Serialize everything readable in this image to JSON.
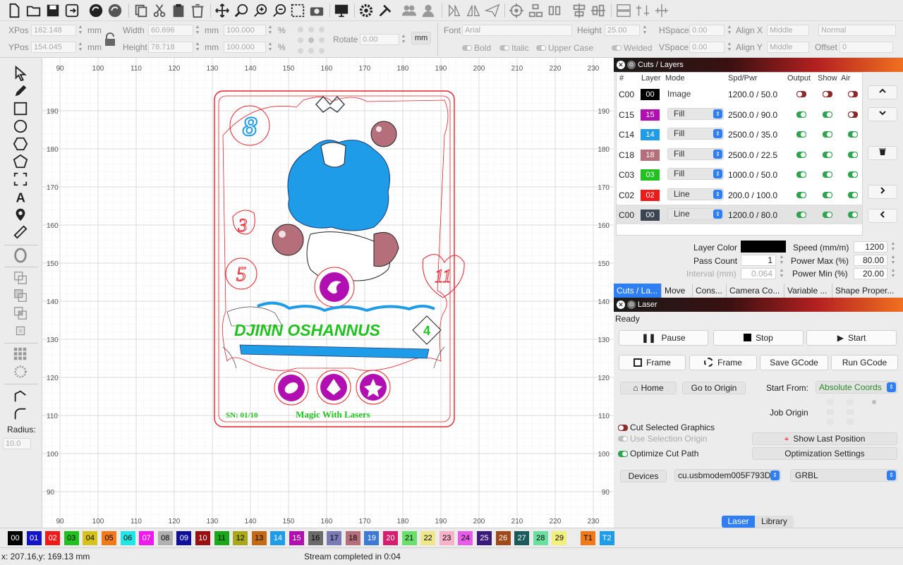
{
  "toolbar": {
    "icons": [
      "new-file-icon",
      "open-folder-icon",
      "save-icon",
      "export-icon",
      "circle-arrow-icon",
      "rotate-icon",
      "copy-icon",
      "cut-icon",
      "paste-icon",
      "trash-icon",
      "move-icon",
      "zoom-pan-icon",
      "zoom-in-icon",
      "zoom-out-icon",
      "select-area-icon",
      "camera-icon",
      "monitor-icon",
      "settings-icon",
      "tools-icon",
      "users-icon",
      "user-icon",
      "mirror-h-icon",
      "mirror-v-icon",
      "send-icon",
      "target-icon",
      "align-icon",
      "distribute-icon",
      "align-center-icon",
      "align-middle-icon",
      "group-icon",
      "ungroup-icon",
      "grid-icon"
    ]
  },
  "props": {
    "xpos_label": "XPos",
    "xpos_value": "162.148",
    "ypos_label": "YPos",
    "ypos_value": "154.045",
    "unit_mm": "mm",
    "width_label": "Width",
    "width_value": "60.696",
    "height_label": "Height",
    "height_value": "78.718",
    "scale_w": "100.000",
    "scale_h": "100.000",
    "pct": "%",
    "rotate_label": "Rotate",
    "rotate_value": "0.00",
    "mm_btn": "mm",
    "font_label": "Font",
    "font_value": "Arial",
    "fheight_label": "Height",
    "fheight_value": "25.00",
    "hspace_label": "HSpace",
    "hspace_value": "0.00",
    "vspace_label": "VSpace",
    "vspace_value": "0.00",
    "alignx_label": "Align X",
    "alignx_value": "Middle",
    "aligny_label": "Align Y",
    "aligny_value": "Middle",
    "normal_value": "Normal",
    "offset_label": "Offset",
    "offset_value": "0",
    "bold": "Bold",
    "italic": "Italic",
    "upper": "Upper Case",
    "welded": "Welded"
  },
  "lefttools": {
    "radius_label": "Radius:",
    "radius_value": "10.0"
  },
  "ruler": {
    "top": [
      "90",
      "100",
      "110",
      "120",
      "130",
      "140",
      "150",
      "160",
      "170",
      "180",
      "190",
      "200",
      "210",
      "220",
      "230"
    ],
    "left": [
      "190",
      "180",
      "170",
      "160",
      "150",
      "140",
      "130",
      "120",
      "110",
      "100",
      "90"
    ]
  },
  "card": {
    "title": "DJINN OSHANNUS",
    "cost_top": "8",
    "left_num1": "3",
    "left_num2": "5",
    "right_num": "11",
    "badge": "4",
    "serial": "SN: 01/10",
    "subtitle": "Magic With Lasers"
  },
  "cuts": {
    "title": "Cuts / Layers",
    "headers": [
      "#",
      "Layer",
      "Mode",
      "Spd/Pwr",
      "Output",
      "Show",
      "Air"
    ],
    "rows": [
      {
        "id": "C00",
        "layer": "00",
        "color": "#000000",
        "mode": "Image",
        "dropdown": false,
        "spd": "1200.0 / 50.0",
        "output": false,
        "show": false,
        "air": false
      },
      {
        "id": "C15",
        "layer": "15",
        "color": "#b10fb1",
        "mode": "Fill",
        "dropdown": true,
        "spd": "2500.0 / 90.0",
        "output": true,
        "show": true,
        "air": false
      },
      {
        "id": "C14",
        "layer": "14",
        "color": "#1f9ce8",
        "mode": "Fill",
        "dropdown": true,
        "spd": "2500.0 / 35.0",
        "output": true,
        "show": true,
        "air": true
      },
      {
        "id": "C18",
        "layer": "18",
        "color": "#b56f7a",
        "mode": "Fill",
        "dropdown": true,
        "spd": "2500.0 / 22.5",
        "output": true,
        "show": true,
        "air": true
      },
      {
        "id": "C03",
        "layer": "03",
        "color": "#21c21f",
        "mode": "Fill",
        "dropdown": true,
        "spd": "1000.0 / 50.0",
        "output": true,
        "show": true,
        "air": true
      },
      {
        "id": "C02",
        "layer": "02",
        "color": "#ef1b1b",
        "mode": "Line",
        "dropdown": true,
        "spd": "200.0 / 100.0",
        "output": true,
        "show": true,
        "air": true
      },
      {
        "id": "C00",
        "layer": "00",
        "color": "#3c4653",
        "mode": "Line",
        "dropdown": true,
        "spd": "1200.0 / 80.0",
        "output": true,
        "show": true,
        "air": true
      }
    ],
    "side_buttons": [
      "chevron-up-icon",
      "chevron-down-icon",
      "trash-icon",
      "chevron-right-icon",
      "chevron-left-icon"
    ],
    "layer_color_label": "Layer Color",
    "speed_label": "Speed (mm/m)",
    "speed_value": "1200",
    "pass_label": "Pass Count",
    "pass_value": "1",
    "powermax_label": "Power Max (%)",
    "powermax_value": "80.00",
    "interval_label": "Interval (mm)",
    "interval_value": "0.064",
    "powermin_label": "Power Min (%)",
    "powermin_value": "20.00"
  },
  "tabs": [
    "Cuts / La...",
    "Move",
    "Cons...",
    "Camera Co...",
    "Variable ...",
    "Shape Proper..."
  ],
  "laser": {
    "title": "Laser",
    "status": "Ready",
    "pause": "Pause",
    "stop": "Stop",
    "start": "Start",
    "frame1": "Frame",
    "frame2": "Frame",
    "save_gcode": "Save GCode",
    "run_gcode": "Run GCode",
    "home": "Home",
    "go_origin": "Go to Origin",
    "start_from_label": "Start From:",
    "start_from_value": "Absolute Coords",
    "job_origin": "Job Origin",
    "cut_selected": "Cut Selected Graphics",
    "use_selection": "Use Selection Origin",
    "optimize": "Optimize Cut Path",
    "show_last": "Show Last Position",
    "opt_settings": "Optimization Settings",
    "devices": "Devices",
    "port": "cu.usbmodem005F793D",
    "controller": "GRBL",
    "tab_laser": "Laser",
    "tab_library": "Library"
  },
  "palette": [
    {
      "t": "00",
      "c": "#000000",
      "f": "#ffffff"
    },
    {
      "t": "01",
      "c": "#1414c8",
      "f": "#ffffff"
    },
    {
      "t": "02",
      "c": "#ef1b1b",
      "f": "#ffffff"
    },
    {
      "t": "03",
      "c": "#21c21f",
      "f": "#000000"
    },
    {
      "t": "04",
      "c": "#d6c21c",
      "f": "#000000"
    },
    {
      "t": "05",
      "c": "#f07a18",
      "f": "#000000"
    },
    {
      "t": "06",
      "c": "#21e6e6",
      "f": "#000000"
    },
    {
      "t": "07",
      "c": "#ef19ef",
      "f": "#ffffff"
    },
    {
      "t": "08",
      "c": "#b0b0b0",
      "f": "#000000"
    },
    {
      "t": "09",
      "c": "#0f0f9a",
      "f": "#ffffff"
    },
    {
      "t": "10",
      "c": "#9a0f0f",
      "f": "#ffffff"
    },
    {
      "t": "11",
      "c": "#19a819",
      "f": "#000000"
    },
    {
      "t": "12",
      "c": "#a8a819",
      "f": "#000000"
    },
    {
      "t": "13",
      "c": "#c46a14",
      "f": "#000000"
    },
    {
      "t": "14",
      "c": "#1f9ce8",
      "f": "#ffffff"
    },
    {
      "t": "15",
      "c": "#b10fb1",
      "f": "#ffffff"
    },
    {
      "t": "16",
      "c": "#6a6a6a",
      "f": "#000000"
    },
    {
      "t": "17",
      "c": "#7a7ab5",
      "f": "#000000"
    },
    {
      "t": "18",
      "c": "#b56f7a",
      "f": "#000000"
    },
    {
      "t": "19",
      "c": "#3c7ad6",
      "f": "#ffffff"
    },
    {
      "t": "20",
      "c": "#d61e6e",
      "f": "#ffffff"
    },
    {
      "t": "21",
      "c": "#6ae06a",
      "f": "#000000"
    },
    {
      "t": "22",
      "c": "#f0e68c",
      "f": "#000000"
    },
    {
      "t": "23",
      "c": "#f5b2c8",
      "f": "#000000"
    },
    {
      "t": "24",
      "c": "#e85ae8",
      "f": "#000000"
    },
    {
      "t": "25",
      "c": "#3a1a7a",
      "f": "#ffffff"
    },
    {
      "t": "26",
      "c": "#a04a1a",
      "f": "#ffffff"
    },
    {
      "t": "27",
      "c": "#1a5a5a",
      "f": "#ffffff"
    },
    {
      "t": "28",
      "c": "#6ae0a0",
      "f": "#000000"
    },
    {
      "t": "29",
      "c": "#f0f07a",
      "f": "#000000"
    },
    {
      "t": "T1",
      "c": "#f07a18",
      "f": "#000000"
    },
    {
      "t": "T2",
      "c": "#1f9ce8",
      "f": "#ffffff"
    }
  ],
  "status": {
    "coords": "x: 207.16,y: 169.13 mm",
    "message": "Stream completed in 0:04"
  }
}
